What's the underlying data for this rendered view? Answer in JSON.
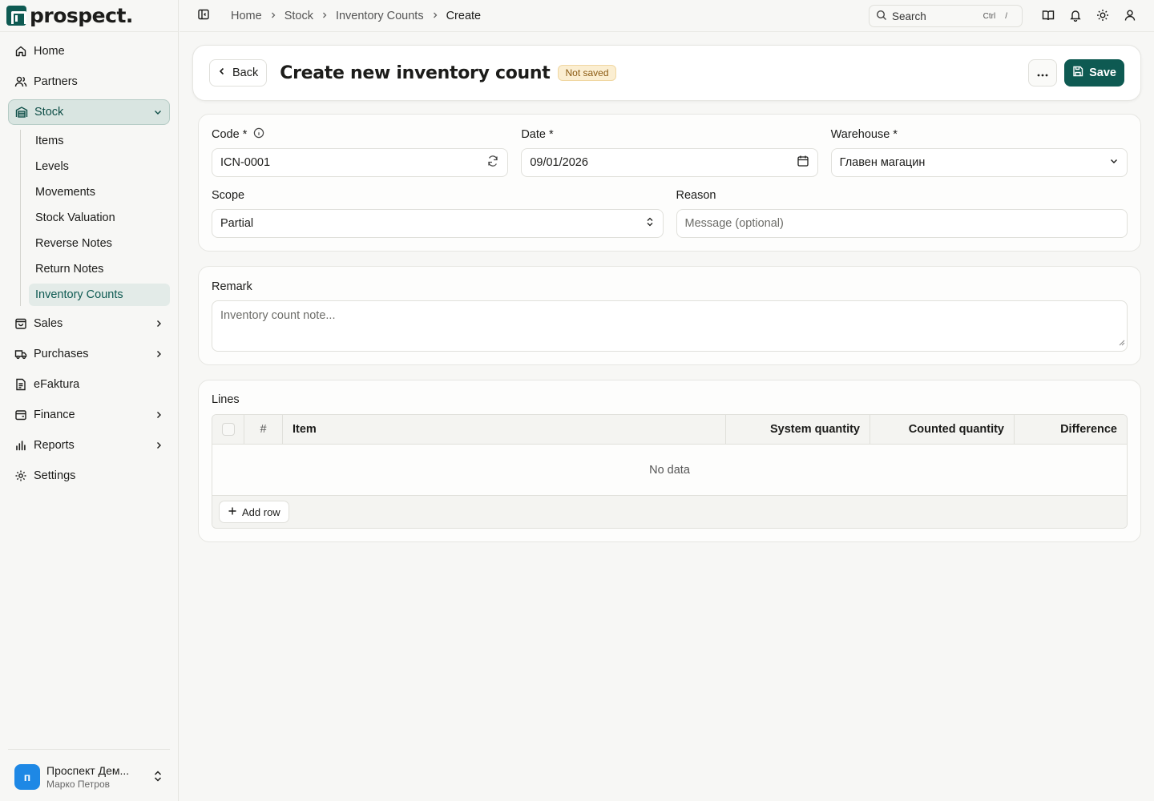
{
  "app": {
    "logo_text": "prospect."
  },
  "sidebar": {
    "items": [
      {
        "label": "Home",
        "icon": "home-icon"
      },
      {
        "label": "Partners",
        "icon": "users-icon"
      },
      {
        "label": "Stock",
        "icon": "warehouse-icon",
        "active": true,
        "expanded": true
      },
      {
        "label": "Sales",
        "icon": "shopping-bag-icon"
      },
      {
        "label": "Purchases",
        "icon": "truck-icon"
      },
      {
        "label": "eFaktura",
        "icon": "document-icon"
      },
      {
        "label": "Finance",
        "icon": "wallet-icon"
      },
      {
        "label": "Reports",
        "icon": "bar-chart-icon"
      },
      {
        "label": "Settings",
        "icon": "gear-icon"
      }
    ],
    "stock_sub": [
      {
        "label": "Items"
      },
      {
        "label": "Levels"
      },
      {
        "label": "Movements"
      },
      {
        "label": "Stock Valuation"
      },
      {
        "label": "Reverse Notes"
      },
      {
        "label": "Return Notes"
      },
      {
        "label": "Inventory Counts",
        "active": true
      }
    ],
    "account": {
      "avatar": "п",
      "name": "Проспект Дем...",
      "user": "Марко Петров"
    }
  },
  "topbar": {
    "breadcrumbs": [
      "Home",
      "Stock",
      "Inventory Counts",
      "Create"
    ],
    "search": {
      "label": "Search",
      "kbd1": "Ctrl",
      "kbd2": "/"
    }
  },
  "header": {
    "back_label": "Back",
    "title": "Create new inventory count",
    "status": "Not saved",
    "save_label": "Save"
  },
  "form": {
    "code": {
      "label": "Code *",
      "value": "ICN-0001"
    },
    "date": {
      "label": "Date *",
      "value": "09/01/2026"
    },
    "warehouse": {
      "label": "Warehouse *",
      "value": "Главен магацин"
    },
    "scope": {
      "label": "Scope",
      "value": "Partial"
    },
    "reason": {
      "label": "Reason",
      "placeholder": "Message (optional)"
    },
    "remark": {
      "label": "Remark",
      "placeholder": "Inventory count note..."
    }
  },
  "lines": {
    "title": "Lines",
    "columns": [
      "#",
      "Item",
      "System quantity",
      "Counted quantity",
      "Difference"
    ],
    "empty_text": "No data",
    "add_row_label": "Add row"
  },
  "colors": {
    "brand": "#0e5a52",
    "badge_bg": "#fbeed1",
    "avatar": "#1e88e5"
  }
}
